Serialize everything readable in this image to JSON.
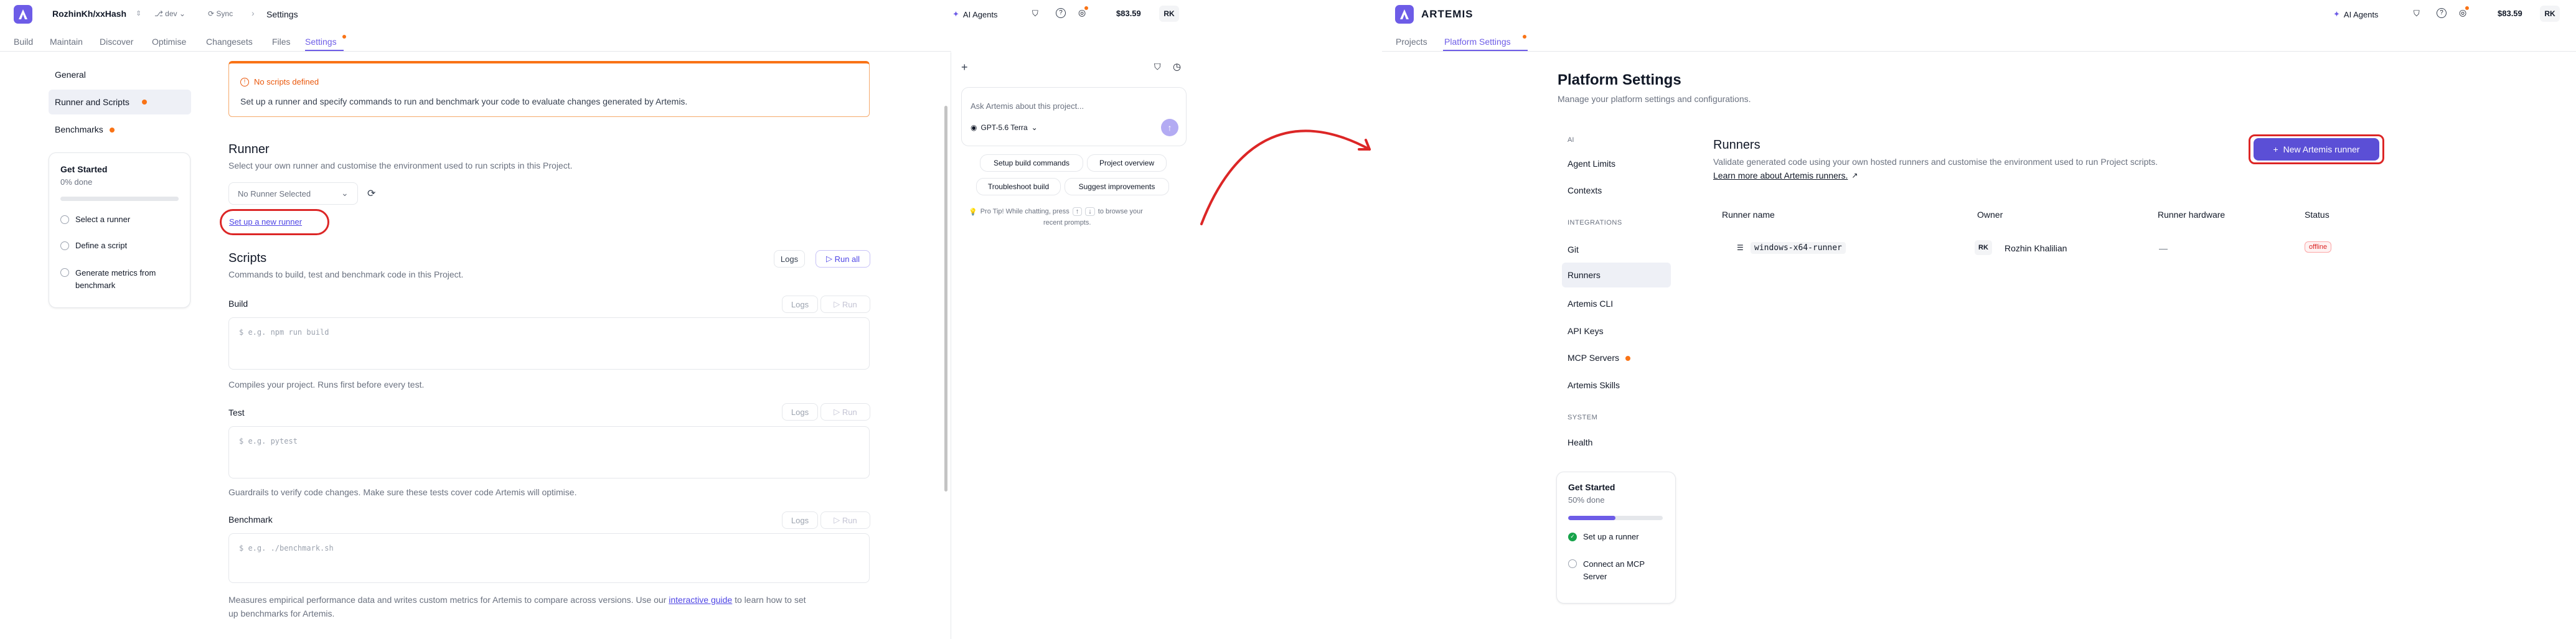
{
  "left": {
    "header": {
      "project": "RozhinKh/xxHash",
      "branch": "dev",
      "sync": "Sync",
      "breadcrumb_page": "Settings",
      "ai_agents": "AI Agents",
      "balance": "$83.59",
      "avatar": "RK"
    },
    "tabs": [
      "Build",
      "Maintain",
      "Discover",
      "Optimise",
      "Changesets",
      "Files",
      "Settings"
    ],
    "sidebar": {
      "items": [
        "General",
        "Runner and Scripts",
        "Benchmarks"
      ],
      "get_started": {
        "title": "Get Started",
        "progress_text": "0% done",
        "progress": 0,
        "steps": [
          "Select a runner",
          "Define a script",
          "Generate metrics from benchmark"
        ]
      }
    },
    "alert": {
      "title": "No scripts defined",
      "body": "Set up a runner and specify commands to run and benchmark your code to evaluate changes generated by Artemis."
    },
    "runner": {
      "title": "Runner",
      "desc": "Select your own runner and customise the environment used to run scripts in this Project.",
      "select_value": "No Runner Selected",
      "setup_link": "Set up a new runner"
    },
    "scripts": {
      "title": "Scripts",
      "desc": "Commands to build, test and benchmark code in this Project.",
      "logs": "Logs",
      "run_all": "Run all",
      "run": "Run",
      "build": {
        "label": "Build",
        "placeholder": "$ e.g. npm run build",
        "help": "Compiles your project. Runs first before every test."
      },
      "test": {
        "label": "Test",
        "placeholder": "$ e.g. pytest",
        "help": "Guardrails to verify code changes. Make sure these tests cover code Artemis will optimise."
      },
      "benchmark": {
        "label": "Benchmark",
        "placeholder": "$ e.g. ./benchmark.sh",
        "help_pre": "Measures empirical performance data and writes custom metrics for Artemis to compare across versions. Use our ",
        "help_link": "interactive guide",
        "help_post": " to learn how to set",
        "help_line2": "up benchmarks for Artemis."
      }
    },
    "chat": {
      "placeholder": "Ask Artemis about this project...",
      "model": "GPT-5.6 Terra",
      "suggestions": [
        "Setup build commands",
        "Project overview",
        "Troubleshoot build",
        "Suggest improvements"
      ],
      "tip_pre": "Pro Tip! While chatting, press",
      "key_up": "↑",
      "key_down": "↓",
      "tip_post": "to browse your",
      "tip_line2": "recent prompts."
    }
  },
  "right": {
    "header": {
      "logo_text": "ARTEMIS",
      "ai_agents": "AI Agents",
      "balance": "$83.59",
      "avatar": "RK"
    },
    "tabs": [
      "Projects",
      "Platform Settings"
    ],
    "page_title": "Platform Settings",
    "page_subtitle": "Manage your platform settings and configurations.",
    "nav": {
      "sections": [
        {
          "title": "AI",
          "items": [
            "Agent Limits",
            "Contexts"
          ]
        },
        {
          "title": "INTEGRATIONS",
          "items": [
            "Git",
            "Runners",
            "Artemis CLI",
            "API Keys",
            "MCP Servers",
            "Artemis Skills"
          ]
        },
        {
          "title": "SYSTEM",
          "items": [
            "Health"
          ]
        }
      ]
    },
    "get_started": {
      "title": "Get Started",
      "progress_text": "50% done",
      "progress": 0.5,
      "steps": [
        "Set up a runner",
        "Connect an MCP Server"
      ]
    },
    "runners": {
      "title": "Runners",
      "desc": "Validate generated code using your own hosted runners and customise the environment used to run Project scripts.",
      "learn_more": "Learn more about Artemis runners.",
      "new_button": "New Artemis runner",
      "columns": [
        "Runner name",
        "Owner",
        "Runner hardware",
        "Status"
      ],
      "rows": [
        {
          "name": "windows-x64-runner",
          "owner_initials": "RK",
          "owner": "Rozhin Khalilian",
          "hardware": "—",
          "status": "offline"
        }
      ]
    }
  },
  "colors": {
    "accent": "#6d5ce7",
    "orange": "#f97316",
    "annotation": "#dc2626"
  }
}
